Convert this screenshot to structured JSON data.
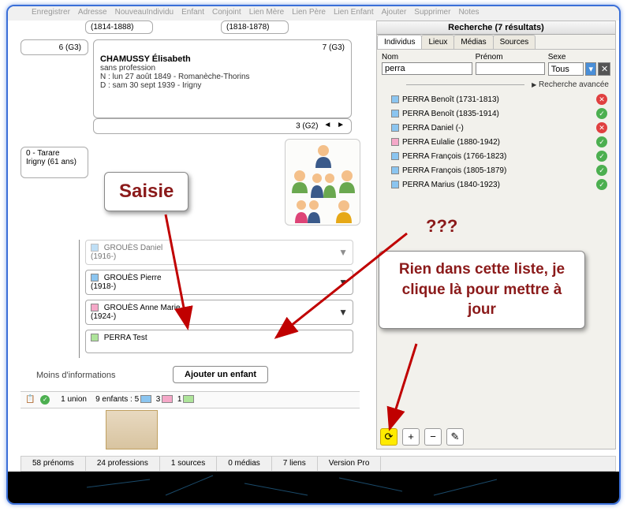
{
  "menubar": [
    "Enregistrer",
    "Adresse",
    "NouveauIndividu",
    "Enfant",
    "Conjoint",
    "Lien Mère",
    "Lien Père",
    "Lien Enfant",
    "Ajouter",
    "Supprimer",
    "Notes"
  ],
  "left": {
    "date1": "(1814-1888)",
    "date2": "(1818-1878)",
    "g3left": "6 (G3)",
    "card": {
      "gen": "7 (G3)",
      "name": "CHAMUSSY Élisabeth",
      "prof": "sans profession",
      "birth": "N : lun 27 août 1849 - Romanèche-Thorins",
      "death": "D : sam 30 sept 1939 - Irigny"
    },
    "g2": "3 (G2)",
    "side1": "0 - Tarare",
    "side2": "Irigny (61 ans)",
    "children": [
      {
        "color": "blue",
        "name": "GROUÈS Daniel",
        "dates": "(1916-)",
        "down": true,
        "fade": true
      },
      {
        "color": "blue",
        "name": "GROUÈS Pierre",
        "dates": "(1918-)",
        "down": true
      },
      {
        "color": "pink",
        "name": "GROUÈS Anne Marie",
        "dates": "(1924-)",
        "down": true
      },
      {
        "color": "green",
        "name": "PERRA Test",
        "dates": "",
        "down": false
      }
    ],
    "moreinfo": "Moins d'informations",
    "addchild": "Ajouter un enfant",
    "stats": {
      "union": "1 union",
      "enfants": "9 enfants :",
      "c1": "5",
      "c2": "3",
      "c3": "1"
    }
  },
  "search": {
    "title": "Recherche (7 résultats)",
    "tabs": [
      "Individus",
      "Lieux",
      "Médias",
      "Sources"
    ],
    "labels": {
      "nom": "Nom",
      "prenom": "Prénom",
      "sexe": "Sexe"
    },
    "nom_val": "perra",
    "sexe_val": "Tous",
    "adv": "Recherche avancée",
    "results": [
      {
        "color": "blue",
        "text": "PERRA Benoît (1731-1813)",
        "status": "bad"
      },
      {
        "color": "blue",
        "text": "PERRA Benoît (1835-1914)",
        "status": "ok"
      },
      {
        "color": "blue",
        "text": "PERRA Daniel (-)",
        "status": "bad"
      },
      {
        "color": "pink",
        "text": "PERRA Eulalie (1880-1942)",
        "status": "ok"
      },
      {
        "color": "blue",
        "text": "PERRA François (1766-1823)",
        "status": "ok"
      },
      {
        "color": "blue",
        "text": "PERRA François (1805-1879)",
        "status": "ok"
      },
      {
        "color": "blue",
        "text": "PERRA Marius (1840-1923)",
        "status": "ok"
      }
    ]
  },
  "bottom": {
    "prenoms": "58 prénoms",
    "prof": "24 professions",
    "src": "1 sources",
    "med": "0 médias",
    "liens": "7 liens",
    "ver": "Version Pro"
  },
  "callouts": {
    "c1": "Saisie",
    "c2": "???",
    "c3": "Rien dans cette liste, je clique là pour mettre à jour"
  }
}
